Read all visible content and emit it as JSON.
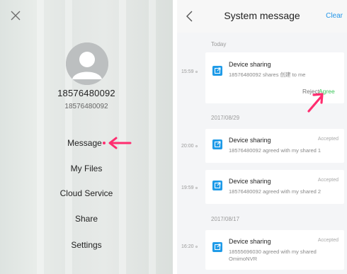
{
  "sidebar": {
    "close_icon": "close-icon",
    "username": "18576480092",
    "user_id": "18576480092",
    "menu": [
      {
        "label": "Message",
        "has_badge": true
      },
      {
        "label": "My Files"
      },
      {
        "label": "Cloud Service"
      },
      {
        "label": "Share"
      },
      {
        "label": "Settings"
      }
    ]
  },
  "header": {
    "title": "System message",
    "clear_label": "Clear"
  },
  "groups": [
    {
      "date": "Today",
      "items": [
        {
          "time": "15:59",
          "title": "Device sharing",
          "body": "18576480092 shares 创建 to me",
          "reject_label": "Reject",
          "agree_label": "Agree"
        }
      ]
    },
    {
      "date": "2017/08/29",
      "items": [
        {
          "time": "20:00",
          "title": "Device sharing",
          "status": "Accepted",
          "body": "18576480092 agreed with my shared 1"
        },
        {
          "time": "19:59",
          "title": "Device sharing",
          "status": "Accepted",
          "body": "18576480092 agreed with my shared 2"
        }
      ]
    },
    {
      "date": "2017/08/17",
      "items": [
        {
          "time": "16:20",
          "title": "Device sharing",
          "status": "Accepted",
          "body": "18555696030 agreed with my shared OmimoNVR"
        }
      ]
    }
  ],
  "colors": {
    "accent_blue": "#2596e8",
    "agree_green": "#3cc65a",
    "arrow_pink": "#ff2d6f",
    "icon_blue": "#1f9be8"
  }
}
